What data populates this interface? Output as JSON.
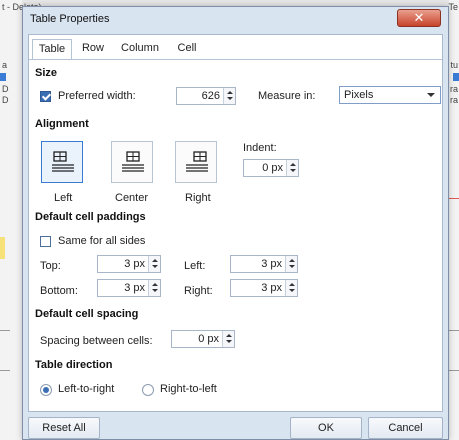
{
  "background": {
    "frag_left_top": "t - Delete)",
    "frag_right_top": "Te",
    "frag_left_1": "a",
    "frag_left_2": "D",
    "frag_left_3": "D",
    "frag_right_1": "tu",
    "frag_right_2": "ra",
    "frag_right_3": "ra"
  },
  "dialog": {
    "title": "Table Properties",
    "close_glyph": "✕"
  },
  "tabs": [
    {
      "label": "Table",
      "active": true
    },
    {
      "label": "Row",
      "active": false
    },
    {
      "label": "Column",
      "active": false
    },
    {
      "label": "Cell",
      "active": false
    }
  ],
  "size": {
    "heading": "Size",
    "preferred_width_label": "Preferred width:",
    "preferred_width_checked": true,
    "preferred_width_value": "626",
    "measure_label": "Measure in:",
    "measure_value": "Pixels"
  },
  "alignment": {
    "heading": "Alignment",
    "options": [
      {
        "label": "Left",
        "selected": true,
        "icon": "align-left-icon"
      },
      {
        "label": "Center",
        "selected": false,
        "icon": "align-center-icon"
      },
      {
        "label": "Right",
        "selected": false,
        "icon": "align-right-icon"
      }
    ],
    "indent_label": "Indent:",
    "indent_value": "0 px"
  },
  "paddings": {
    "heading": "Default cell paddings",
    "same_all_label": "Same for all sides",
    "same_all_checked": false,
    "top_label": "Top:",
    "top_value": "3 px",
    "left_label": "Left:",
    "left_value": "3 px",
    "bottom_label": "Bottom:",
    "bottom_value": "3 px",
    "right_label": "Right:",
    "right_value": "3 px"
  },
  "spacing": {
    "heading": "Default cell spacing",
    "between_label": "Spacing between cells:",
    "between_value": "0 px"
  },
  "direction": {
    "heading": "Table direction",
    "ltr_label": "Left-to-right",
    "ltr_checked": true,
    "rtl_label": "Right-to-left",
    "rtl_checked": false
  },
  "footer": {
    "reset_label": "Reset All",
    "ok_label": "OK",
    "cancel_label": "Cancel"
  }
}
